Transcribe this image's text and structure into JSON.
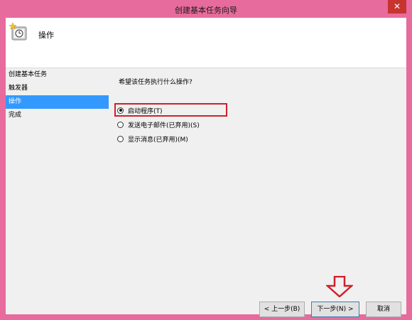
{
  "window": {
    "title": "创建基本任务向导",
    "close_label": "✕"
  },
  "header": {
    "title": "操作"
  },
  "nav": {
    "items": [
      {
        "label": "创建基本任务"
      },
      {
        "label": "触发器"
      },
      {
        "label": "操作"
      },
      {
        "label": "完成"
      }
    ],
    "selected_index": 2
  },
  "content": {
    "question": "希望该任务执行什么操作?",
    "options": [
      {
        "label": "启动程序(T)",
        "checked": true
      },
      {
        "label": "发送电子邮件(已弃用)(S)",
        "checked": false
      },
      {
        "label": "显示消息(已弃用)(M)",
        "checked": false
      }
    ]
  },
  "buttons": {
    "back": "< 上一步(B)",
    "next": "下一步(N) >",
    "cancel": "取消"
  },
  "colors": {
    "window_frame": "#e76b9c",
    "selected_nav": "#3399ff",
    "annotation_red": "#d0202a",
    "close_button": "#c7332e"
  },
  "icons": {
    "header": "task-clock-icon",
    "close": "close-icon",
    "annotation": "down-arrow-icon"
  }
}
